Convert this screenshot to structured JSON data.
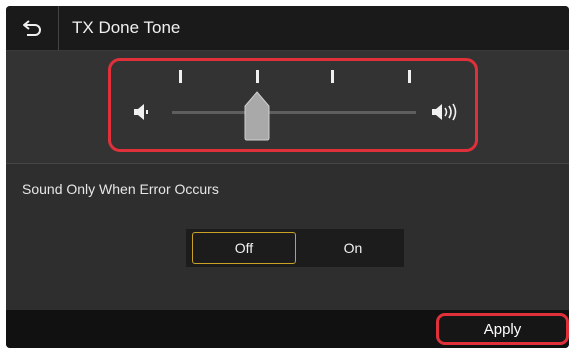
{
  "header": {
    "title": "TX Done Tone",
    "back_icon": "back-arrow-icon"
  },
  "volume": {
    "level_index": 1,
    "levels": 4,
    "min_icon": "speaker-low-icon",
    "max_icon": "speaker-high-icon",
    "highlight_color": "#e0313b"
  },
  "error_sound": {
    "label": "Sound Only When Error Occurs",
    "options": [
      "Off",
      "On"
    ],
    "selected": "Off",
    "selected_color": "#c9a227"
  },
  "footer": {
    "apply_label": "Apply"
  }
}
